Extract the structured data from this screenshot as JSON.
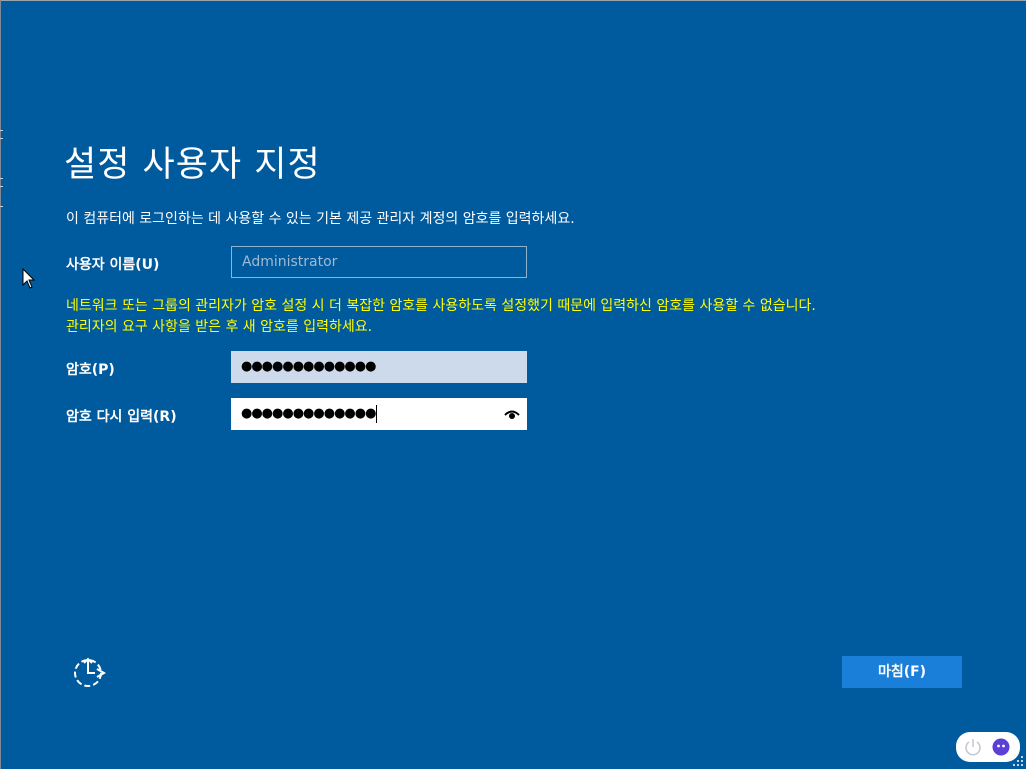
{
  "title": "설정 사용자 지정",
  "description": "이 컴퓨터에 로그인하는 데 사용할 수 있는 기본 제공 관리자 계정의 암호를 입력하세요.",
  "username": {
    "label": "사용자 이름(U)",
    "placeholder": "Administrator"
  },
  "warning": {
    "line1": "네트워크 또는 그룹의 관리자가 암호 설정 시 더 복잡한 암호를 사용하도록 설정했기 때문에 입력하신 암호를 사용할 수 없습니다.",
    "line2": "관리자의 요구 사항을 받은 후 새 암호를 입력하세요."
  },
  "password": {
    "label": "암호(P)",
    "value": "●●●●●●●●●●●●●"
  },
  "confirm": {
    "label": "암호 다시 입력(R)",
    "value": "●●●●●●●●●●●●●"
  },
  "buttons": {
    "finish": "마침(F)"
  },
  "icons": {
    "ease_of_access": "ease-of-access-icon",
    "reveal": "eye-icon",
    "power": "power-icon",
    "app": "chat-bubble-icon"
  },
  "colors": {
    "background": "#005a9e",
    "warning": "#ffff00",
    "button": "#1a7fd9",
    "tray_app": "#5b3fd6"
  }
}
